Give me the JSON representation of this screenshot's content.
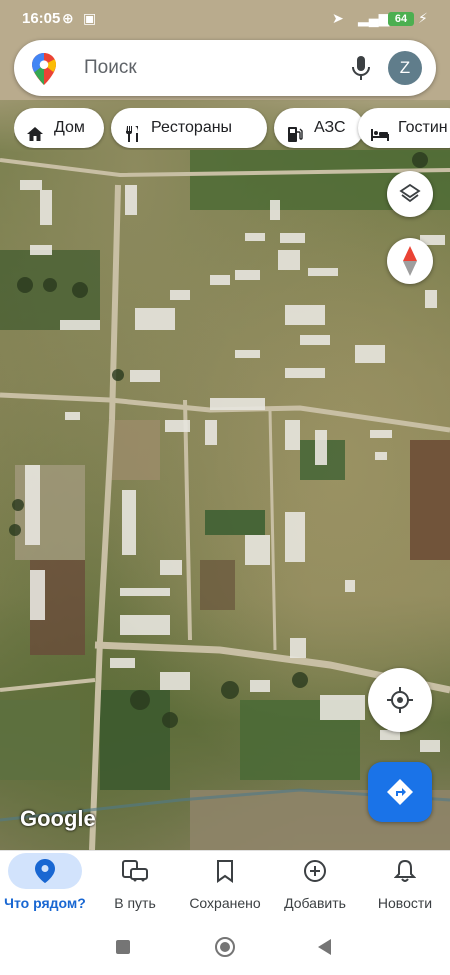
{
  "status_bar": {
    "time": "16:05",
    "battery": "64"
  },
  "search": {
    "placeholder": "Поиск",
    "avatar_letter": "Z"
  },
  "chips": [
    {
      "label": "Дом",
      "icon": "home-icon"
    },
    {
      "label": "Рестораны",
      "icon": "restaurant-icon"
    },
    {
      "label": "АЗС",
      "icon": "gas-station-icon"
    },
    {
      "label": "Гостин",
      "icon": "hotel-icon"
    }
  ],
  "map": {
    "attribution": "Google",
    "layer_button_icon": "layers-icon",
    "compass_icon": "compass-icon",
    "location_button_icon": "my-location-icon",
    "directions_button_icon": "directions-icon"
  },
  "bottom_nav": [
    {
      "label": "Что рядом?",
      "icon": "explore-pin-icon",
      "active": true
    },
    {
      "label": "В путь",
      "icon": "commute-icon",
      "active": false
    },
    {
      "label": "Сохранено",
      "icon": "bookmark-icon",
      "active": false
    },
    {
      "label": "Добавить",
      "icon": "add-circle-icon",
      "active": false
    },
    {
      "label": "Новости",
      "icon": "bell-icon",
      "active": false
    }
  ],
  "colors": {
    "accent": "#1a73e8",
    "active_tab": "#1967d2",
    "battery": "#4caf50"
  }
}
